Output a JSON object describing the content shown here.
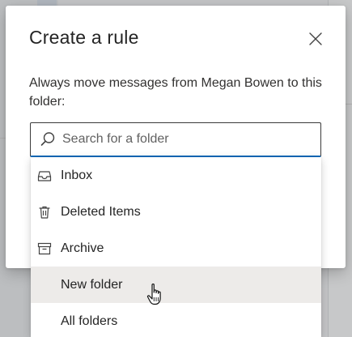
{
  "dialog": {
    "title": "Create a rule",
    "instructions": "Always move messages from Megan Bowen to this folder:",
    "close_icon": "close-icon"
  },
  "search": {
    "placeholder": "Search for a folder",
    "value": "",
    "icon": "search-icon"
  },
  "folders": [
    {
      "label": "Inbox",
      "icon": "inbox-icon"
    },
    {
      "label": "Deleted Items",
      "icon": "trash-icon"
    },
    {
      "label": "Archive",
      "icon": "archive-icon"
    },
    {
      "label": "New folder",
      "icon": "",
      "hovered": true
    },
    {
      "label": "All folders",
      "icon": ""
    }
  ],
  "colors": {
    "accent": "#0f6cbd",
    "hover": "#edebe9"
  }
}
